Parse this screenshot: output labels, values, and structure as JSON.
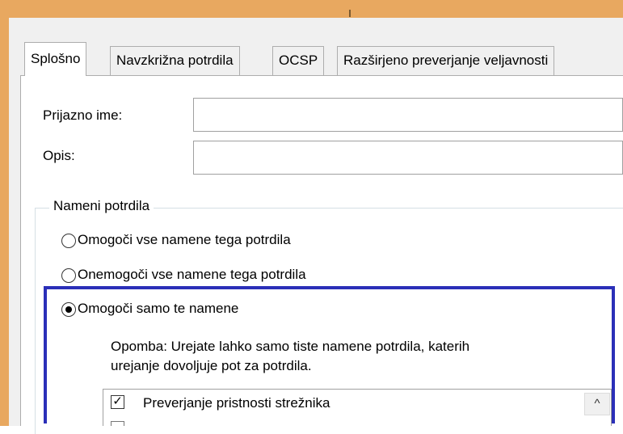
{
  "tabs": [
    {
      "label": "Splošno",
      "active": true
    },
    {
      "label": "Navzkrižna potrdila",
      "active": false
    },
    {
      "label": "OCSP",
      "active": false
    },
    {
      "label": "Razširjeno preverjanje veljavnosti",
      "active": false
    }
  ],
  "fields": {
    "friendly_name_label": "Prijazno ime:",
    "friendly_name_value": "",
    "description_label": "Opis:",
    "description_value": ""
  },
  "purposes": {
    "group_title": "Nameni potrdila",
    "options": [
      {
        "label": "Omogoči vse namene tega potrdila",
        "selected": false
      },
      {
        "label": "Onemogoči vse namene tega potrdila",
        "selected": false
      },
      {
        "label": "Omogoči samo te namene",
        "selected": true
      }
    ],
    "note_line1": "Opomba: Urejate lahko samo tiste namene potrdila, katerih",
    "note_line2": "urejanje dovoljuje pot za potrdila.",
    "list_items": [
      {
        "label": "Preverjanje pristnosti strežnika",
        "checked": true,
        "check_glyph": "✓"
      }
    ],
    "scroll_up_glyph": "^"
  },
  "colors": {
    "title_bar": "#e8a860",
    "highlight_border": "#2b2fb8",
    "dialog_bg": "#f0f0f0"
  }
}
